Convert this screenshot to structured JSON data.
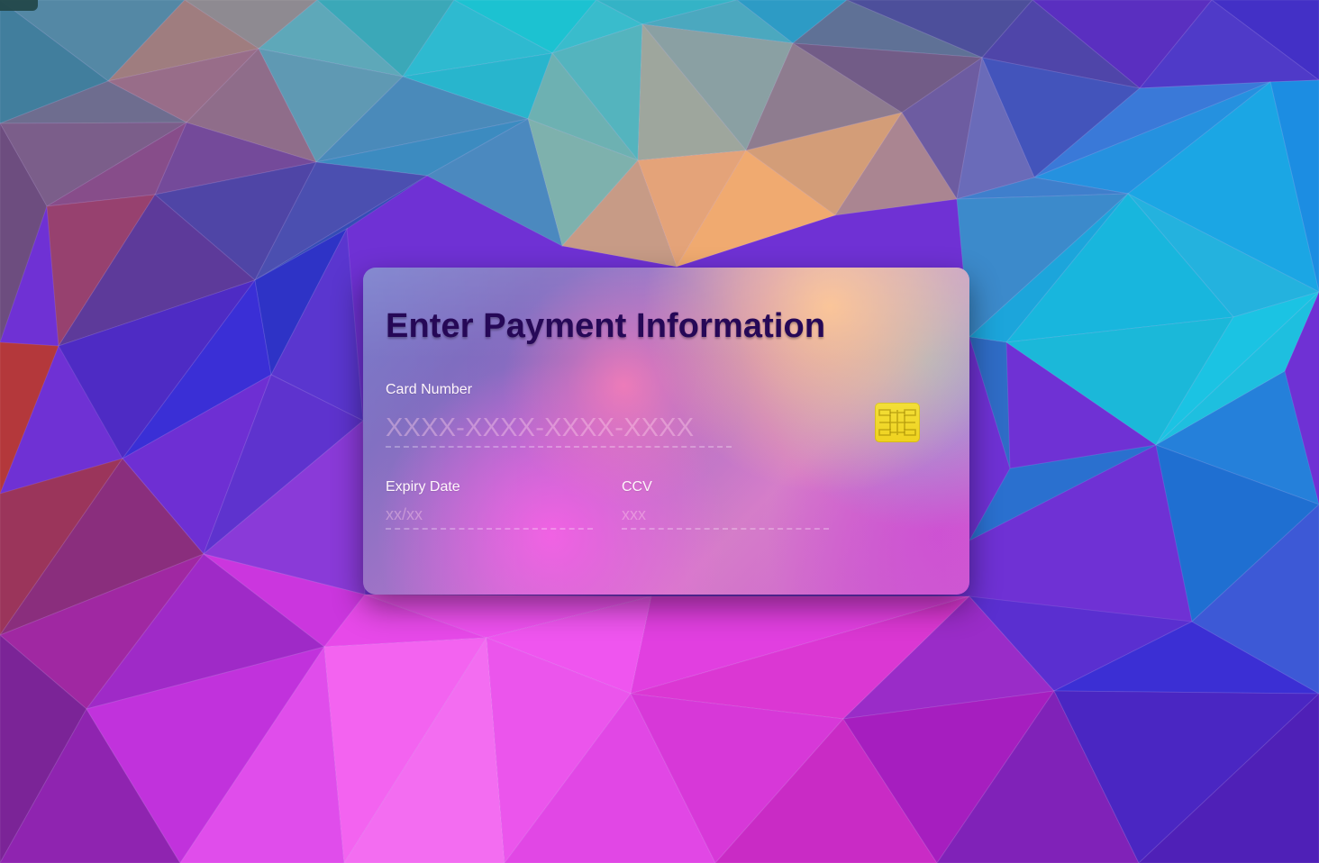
{
  "colors": {
    "title": "#260857",
    "label": "#fff5fb",
    "chip": "#efd21f"
  },
  "background": {
    "name": "low-poly gradient background"
  },
  "payment_card": {
    "title": "Enter Payment Information",
    "card_number_label": "Card Number",
    "card_number_placeholder": "XXXX-XXXX-XXXX-XXXX",
    "expiry_label": "Expiry Date",
    "expiry_placeholder": "xx/xx",
    "ccv_label": "CCV",
    "ccv_placeholder": "xxx"
  },
  "icons": {
    "chip": "card-chip-icon"
  }
}
